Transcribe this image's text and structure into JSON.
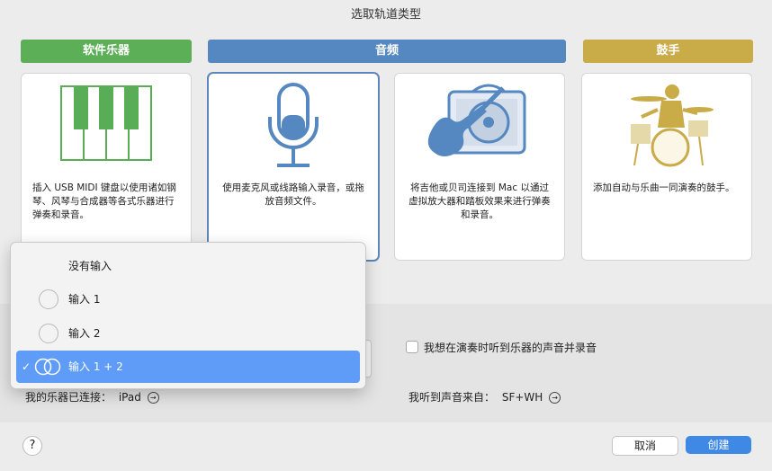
{
  "window": {
    "title": "选取轨道类型"
  },
  "categories": [
    {
      "header": "软件乐器",
      "color": "#5caf57"
    },
    {
      "header": "音频",
      "color": "#5587c0"
    },
    {
      "header": "鼓手",
      "color": "#c9ab48"
    }
  ],
  "cards": [
    {
      "icon": "piano-keyboard-icon",
      "desc": "插入 USB MIDI 键盘以使用诸如钢琴、风琴与合成器等各式乐器进行弹奏和录音。",
      "selected": false
    },
    {
      "icon": "microphone-icon",
      "desc": "使用麦克风或线路输入录音，或拖放音频文件。",
      "selected": true
    },
    {
      "icon": "guitar-amp-icon",
      "desc": "将吉他或贝司连接到 Mac 以通过虚拟放大器和踏板效果来进行弹奏和录音。",
      "selected": false
    },
    {
      "icon": "drummer-icon",
      "desc": "添加自动与乐曲一同演奏的鼓手。",
      "selected": false
    }
  ],
  "input_menu": {
    "items": [
      {
        "label": "没有输入",
        "icon": "",
        "checked": false
      },
      {
        "label": "输入 1",
        "icon": "mono-input-icon",
        "checked": false
      },
      {
        "label": "输入 2",
        "icon": "mono-input-icon",
        "checked": false
      },
      {
        "label": "输入 1 + 2",
        "icon": "stereo-input-icon",
        "checked": true
      }
    ],
    "check_mark": "✓"
  },
  "settings": {
    "monitor_checkbox_label": "我想在演奏时听到乐器的声音并录音",
    "monitor_checked": false,
    "instrument_label": "我的乐器已连接：",
    "instrument_value": "iPad",
    "output_label": "我听到声音来自：",
    "output_value": "SF+WH",
    "arrow_glyph": "→"
  },
  "footer": {
    "help": "?",
    "cancel": "取消",
    "create": "创建"
  },
  "colors": {
    "accent": "#3e89e6",
    "menu_selection": "#5f9cf7"
  }
}
